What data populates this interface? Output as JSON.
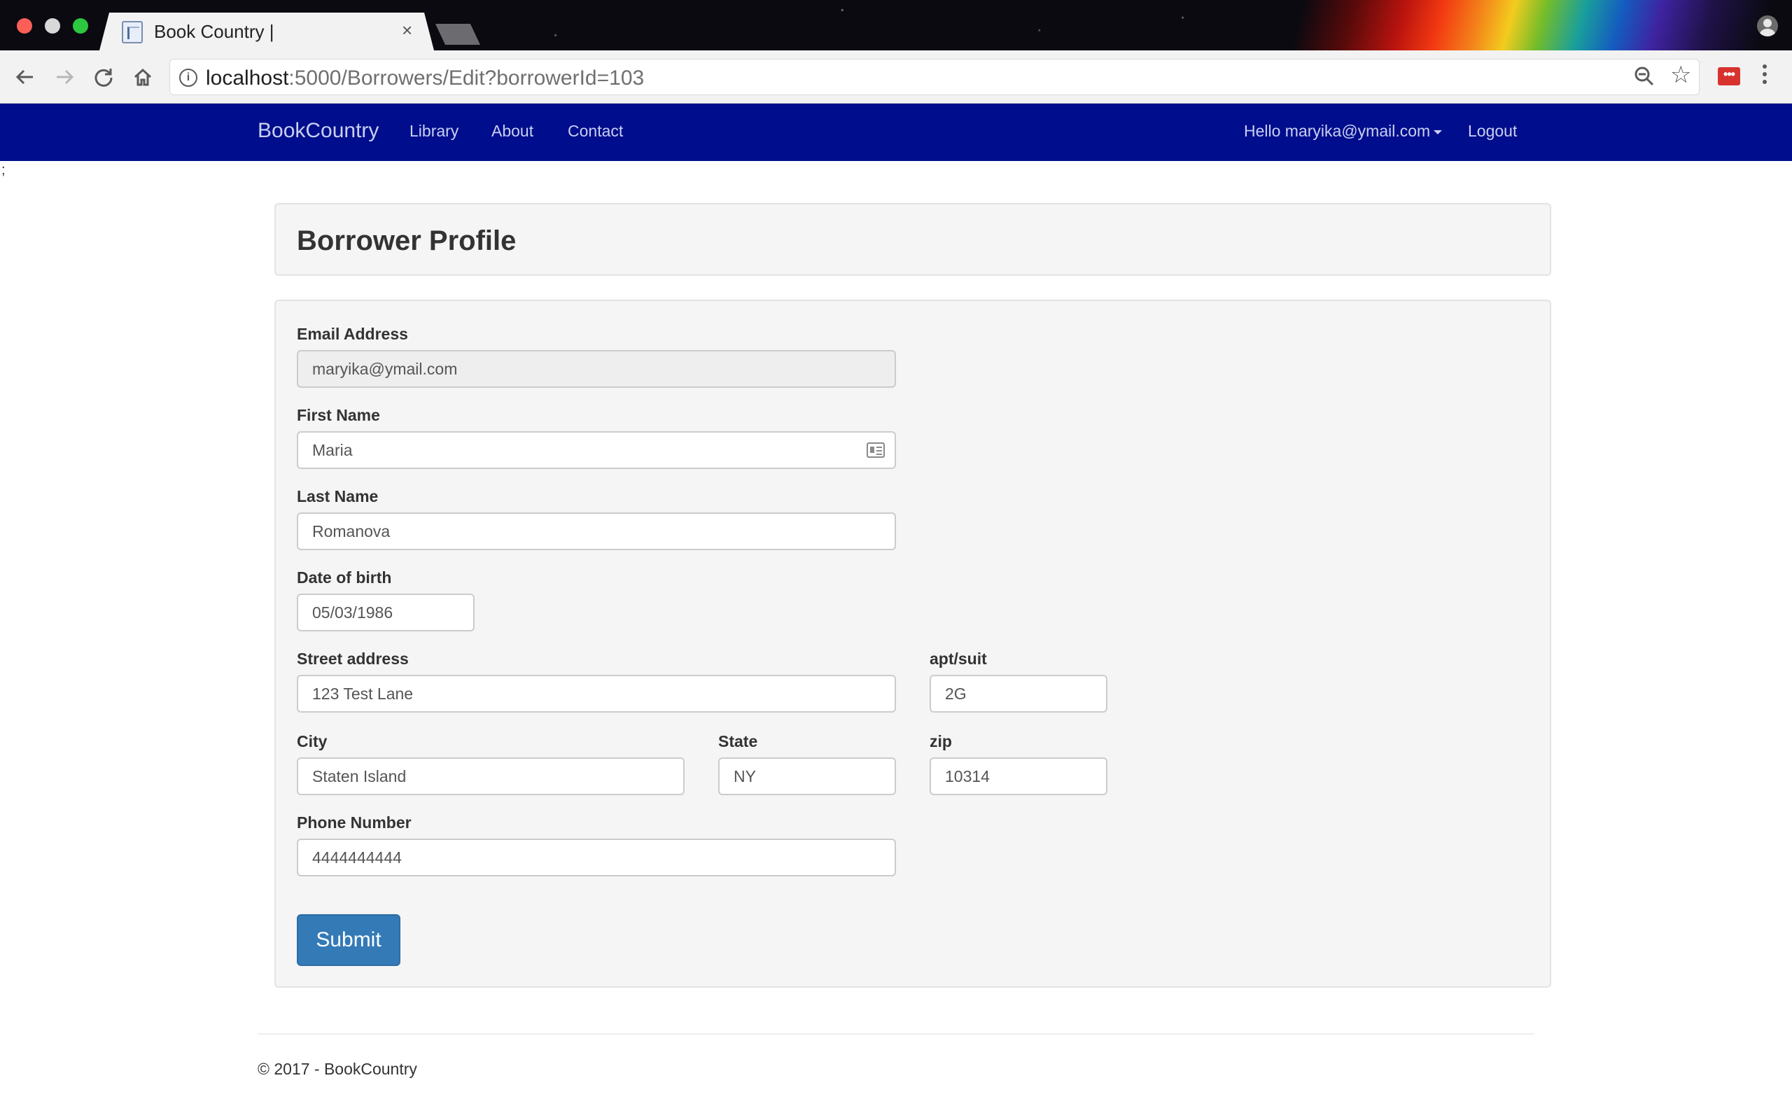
{
  "browser": {
    "tab_title": "Book Country |",
    "tab_close": "×",
    "url_host": "localhost",
    "url_rest": ":5000/Borrowers/Edit?borrowerId=103",
    "ext_label": "•••",
    "icons": [
      "back-arrow-icon",
      "forward-arrow-icon",
      "reload-icon",
      "home-icon",
      "info-icon",
      "zoom-icon",
      "star-icon",
      "extension-icon",
      "menu-icon",
      "profile-icon"
    ]
  },
  "navbar": {
    "brand": "BookCountry",
    "links": [
      "Library",
      "About",
      "Contact"
    ],
    "user_greeting": "Hello maryika@ymail.com",
    "logout": "Logout",
    "background_color": "#000d8c"
  },
  "stray_text": ";",
  "page": {
    "title": "Borrower Profile"
  },
  "form": {
    "email": {
      "label": "Email Address",
      "value": "maryika@ymail.com"
    },
    "first_name": {
      "label": "First Name",
      "value": "Maria"
    },
    "last_name": {
      "label": "Last Name",
      "value": "Romanova"
    },
    "dob": {
      "label": "Date of birth",
      "value": "05/03/1986"
    },
    "street": {
      "label": "Street address",
      "value": "123 Test Lane"
    },
    "apt": {
      "label": "apt/suit",
      "value": "2G"
    },
    "city": {
      "label": "City",
      "value": "Staten Island"
    },
    "state": {
      "label": "State",
      "value": "NY"
    },
    "zip": {
      "label": "zip",
      "value": "10314"
    },
    "phone": {
      "label": "Phone Number",
      "value": "4444444444"
    },
    "submit_label": "Submit",
    "submit_color": "#337ab7"
  },
  "footer": {
    "text": "© 2017 - BookCountry"
  }
}
